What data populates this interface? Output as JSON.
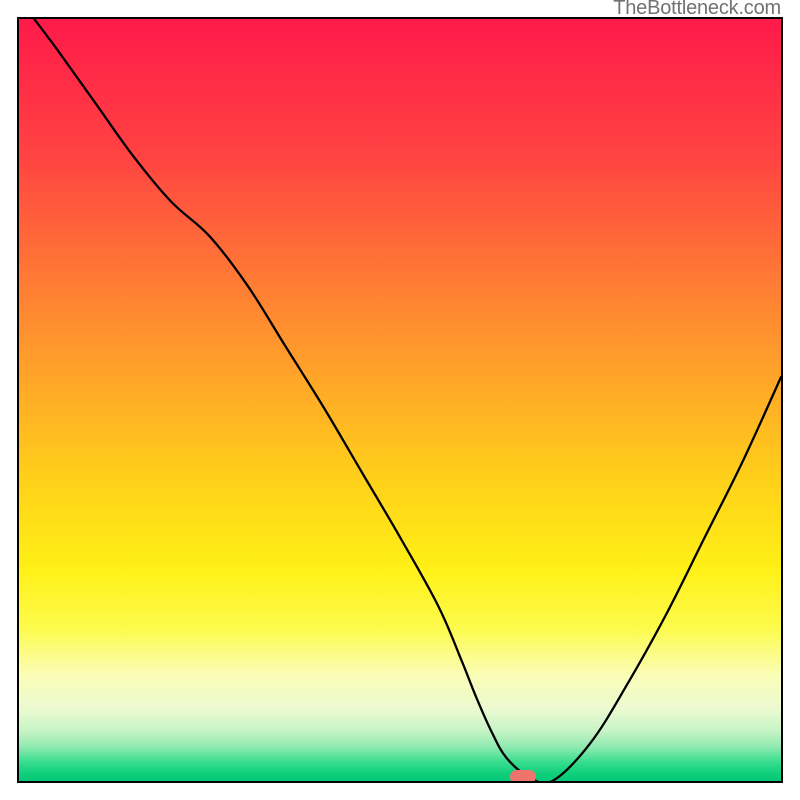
{
  "watermark": "TheBottleneck.com",
  "chart_data": {
    "type": "line",
    "title": "",
    "xlabel": "",
    "ylabel": "",
    "xlim": [
      0,
      100
    ],
    "ylim": [
      0,
      100
    ],
    "grid": false,
    "legend": false,
    "gradient_stops": [
      {
        "offset": 0,
        "color": "#ff1a4a"
      },
      {
        "offset": 0.18,
        "color": "#ff4342"
      },
      {
        "offset": 0.4,
        "color": "#ff8e30"
      },
      {
        "offset": 0.6,
        "color": "#ffcf1a"
      },
      {
        "offset": 0.72,
        "color": "#fff016"
      },
      {
        "offset": 0.8,
        "color": "#fdfb4d"
      },
      {
        "offset": 0.86,
        "color": "#fbfdb6"
      },
      {
        "offset": 0.905,
        "color": "#ecfad1"
      },
      {
        "offset": 0.935,
        "color": "#c6f4c6"
      },
      {
        "offset": 0.955,
        "color": "#90eab0"
      },
      {
        "offset": 0.975,
        "color": "#38de8f"
      },
      {
        "offset": 0.99,
        "color": "#0fcf7c"
      },
      {
        "offset": 1.0,
        "color": "#05c878"
      }
    ],
    "series": [
      {
        "name": "bottleneck-curve",
        "color": "#000000",
        "x": [
          2,
          5,
          10,
          15,
          20,
          25,
          30,
          35,
          40,
          45,
          50,
          55,
          58,
          60,
          62,
          64,
          67,
          70,
          75,
          80,
          85,
          90,
          95,
          100
        ],
        "y": [
          100,
          96,
          89,
          82,
          76,
          71.5,
          65,
          57,
          49,
          40.5,
          32,
          23,
          16,
          11,
          6.5,
          3,
          0.5,
          0,
          5,
          13,
          22,
          32,
          42,
          53
        ]
      }
    ],
    "marker": {
      "x": 66.2,
      "y": 0.5,
      "color": "#f0736c",
      "width_pct": 3.4,
      "height_pct": 1.8
    }
  }
}
